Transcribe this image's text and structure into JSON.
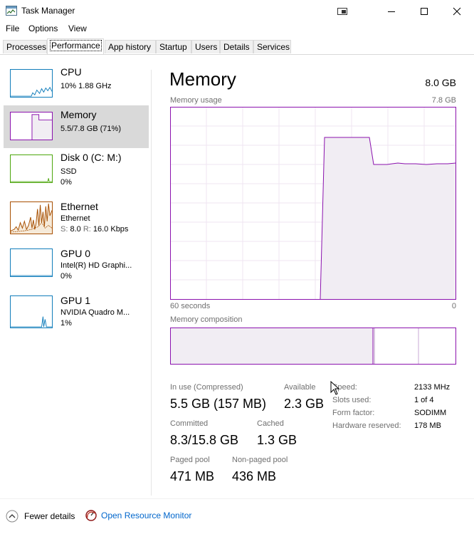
{
  "window": {
    "title": "Task Manager"
  },
  "menu": [
    "File",
    "Options",
    "View"
  ],
  "tabs": [
    "Processes",
    "Performance",
    "App history",
    "Startup",
    "Users",
    "Details",
    "Services"
  ],
  "sidebar": {
    "cpu": {
      "name": "CPU",
      "line1": "10%  1.88 GHz"
    },
    "memory": {
      "name": "Memory",
      "line1": "5.5/7.8 GB (71%)"
    },
    "disk": {
      "name": "Disk 0 (C: M:)",
      "line1": "SSD",
      "line2": "0%"
    },
    "ethernet": {
      "name": "Ethernet",
      "line1": "Ethernet",
      "s_label": "S:",
      "s_value": "8.0",
      "r_label": "R:",
      "r_value": "16.0 Kbps"
    },
    "gpu0": {
      "name": "GPU 0",
      "line1": "Intel(R) HD Graphi...",
      "line2": "0%"
    },
    "gpu1": {
      "name": "GPU 1",
      "line1": "NVIDIA Quadro M...",
      "line2": "1%"
    }
  },
  "main": {
    "title": "Memory",
    "total": "8.0 GB",
    "usage_label": "Memory usage",
    "usage_max": "7.8 GB",
    "axis_left": "60 seconds",
    "axis_right": "0",
    "composition_label": "Memory composition",
    "stats": {
      "in_use_label": "In use (Compressed)",
      "in_use_value": "5.5 GB (157 MB)",
      "available_label": "Available",
      "available_value": "2.3 GB",
      "committed_label": "Committed",
      "committed_value": "8.3/15.8 GB",
      "cached_label": "Cached",
      "cached_value": "1.3 GB",
      "paged_label": "Paged pool",
      "paged_value": "471 MB",
      "nonpaged_label": "Non-paged pool",
      "nonpaged_value": "436 MB"
    },
    "specs": [
      {
        "label": "Speed:",
        "value": "2133 MHz"
      },
      {
        "label": "Slots used:",
        "value": "1 of 4"
      },
      {
        "label": "Form factor:",
        "value": "SODIMM"
      },
      {
        "label": "Hardware reserved:",
        "value": "178 MB"
      }
    ]
  },
  "footer": {
    "fewer_details": "Fewer details",
    "resource_monitor": "Open Resource Monitor"
  },
  "colors": {
    "memory_accent": "#8b12ae",
    "cpu_accent": "#117dbb",
    "disk_accent": "#4da60c",
    "ethernet_accent": "#a74f01",
    "link": "#0066cc"
  }
}
